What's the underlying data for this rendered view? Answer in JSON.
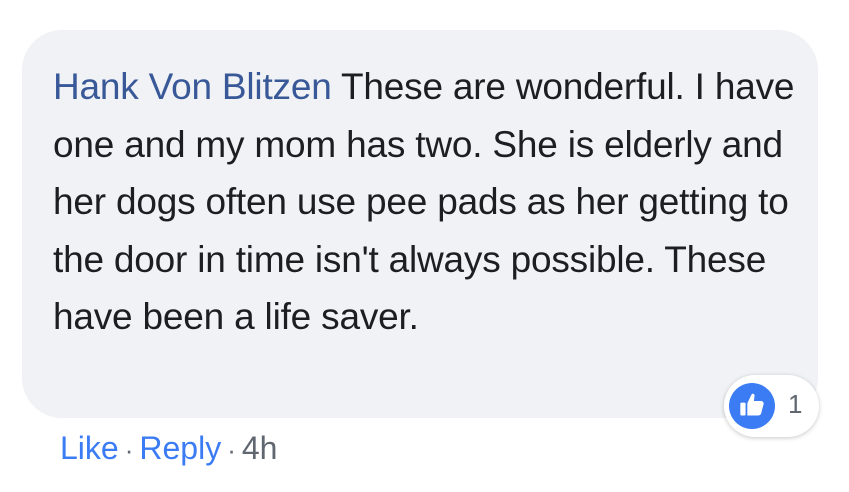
{
  "comment": {
    "author": "Hank Von Blitzen",
    "text": "These are wonderful. I have one and my mom has two. She is elderly and her dogs often use pee pads as her getting to the door in time isn't always possible. These have been a life saver."
  },
  "reactions": {
    "icon": "like-thumbs-up-icon",
    "count": "1"
  },
  "actions": {
    "like_label": "Like",
    "reply_label": "Reply",
    "separator": "·",
    "timestamp": "4h"
  },
  "colors": {
    "bubble_background": "#f0f2f5",
    "author_name": "#385898",
    "link_blue": "#3b7cf4",
    "muted_text": "#606770",
    "body_text": "#1c1e21"
  }
}
